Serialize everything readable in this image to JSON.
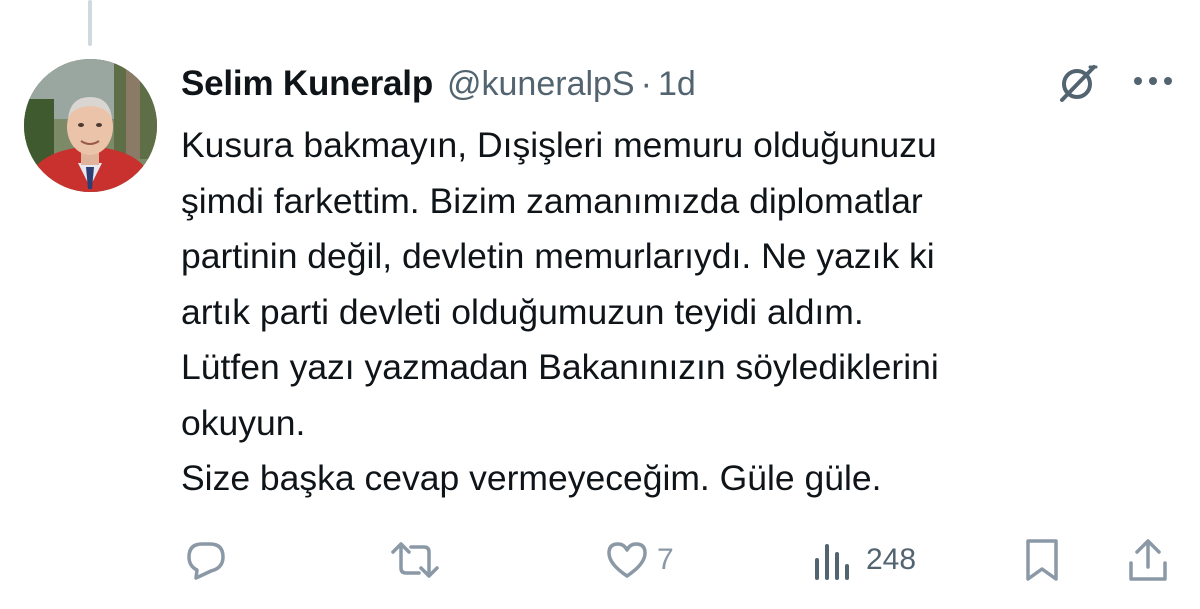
{
  "tweet": {
    "display_name": "Selim Kuneralp",
    "handle": "@kuneralpS",
    "separator": "·",
    "time": "1d",
    "avatar_icon": "profile-photo",
    "body_lines": [
      "Kusura bakmayın, Dışişleri memuru olduğunuzu",
      "şimdi farkettim. Bizim zamanımızda diplomatlar",
      "partinin değil, devletin memurlarıydı. Ne yazık ki",
      "artık parti devleti olduğumuzun teyidi aldım.",
      "Lütfen yazı yazmadan Bakanınızın söylediklerini",
      "okuyun.",
      "Size başka cevap vermeyeceğim. Güle güle."
    ]
  },
  "actions": {
    "reply": {
      "icon": "reply-icon",
      "count": ""
    },
    "repost": {
      "icon": "repost-icon",
      "count": ""
    },
    "like": {
      "icon": "heart-icon",
      "count": "7"
    },
    "views": {
      "icon": "views-icon",
      "count": "248"
    },
    "bookmark": {
      "icon": "bookmark-icon"
    },
    "share": {
      "icon": "share-icon"
    }
  },
  "colors": {
    "text": "#0f1419",
    "secondary": "#536471",
    "icon": "#8b98a5",
    "thread_line": "#cfd9de"
  }
}
